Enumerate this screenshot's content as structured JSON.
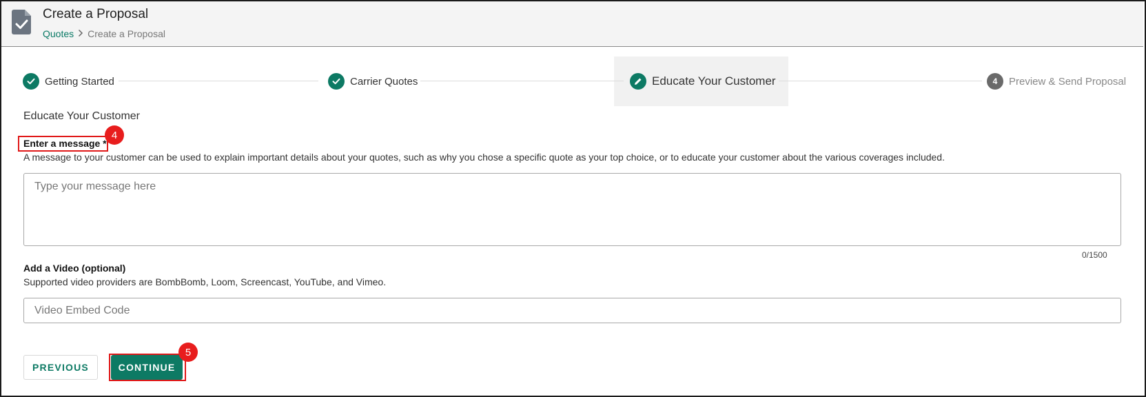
{
  "header": {
    "title": "Create a Proposal",
    "breadcrumb": {
      "link": "Quotes",
      "separator": ">",
      "current": "Create a Proposal"
    },
    "icon": "document-check-icon"
  },
  "stepper": {
    "steps": [
      {
        "label": "Getting Started",
        "state": "done",
        "icon": "check-icon"
      },
      {
        "label": "Carrier Quotes",
        "state": "done",
        "icon": "check-icon"
      },
      {
        "label": "Educate Your Customer",
        "state": "active",
        "icon": "pencil-icon"
      },
      {
        "label": "Preview & Send Proposal",
        "state": "pending",
        "number": "4"
      }
    ]
  },
  "section": {
    "title": "Educate Your Customer"
  },
  "message": {
    "label": "Enter a message *",
    "help": "A message to your customer can be used to explain important details about your quotes, such as why you chose a specific quote as your top choice, or to educate your customer about the various coverages included.",
    "placeholder": "Type your message here",
    "value": "",
    "char_count": "0/1500"
  },
  "video": {
    "label": "Add a Video (optional)",
    "help": "Supported video providers are BombBomb, Loom, Screencast, YouTube, and Vimeo.",
    "placeholder": "Video Embed Code",
    "value": ""
  },
  "actions": {
    "previous_label": "PREVIOUS",
    "continue_label": "CONTINUE"
  },
  "annotations": {
    "badge_message": "4",
    "badge_continue": "5"
  },
  "colors": {
    "brand_green": "#0d7a64",
    "annotation_red": "#e01818"
  }
}
